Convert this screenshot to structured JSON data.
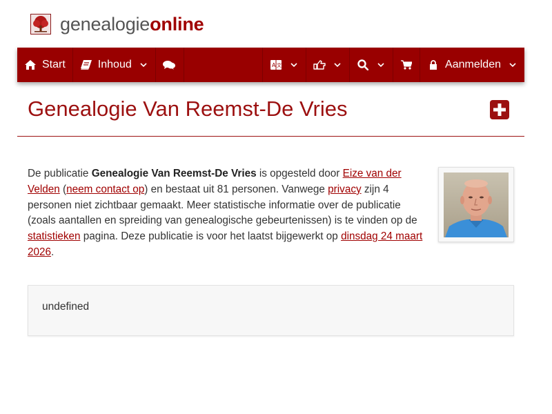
{
  "brand": {
    "name_light": "genealogie",
    "name_bold": "online",
    "logo_icon": "tree-icon"
  },
  "colors": {
    "primary": "#990000",
    "link": "#a00000",
    "title": "#9c1010"
  },
  "nav": {
    "start": {
      "icon": "home-icon",
      "label": "Start"
    },
    "inhoud": {
      "icon": "book-icon",
      "label": "Inhoud"
    },
    "chat": {
      "icon": "comments-icon"
    },
    "language": {
      "icon": "language-icon"
    },
    "share": {
      "icon": "hand-pointer-icon"
    },
    "search": {
      "icon": "search-icon"
    },
    "cart": {
      "icon": "cart-icon"
    },
    "login": {
      "icon": "lock-icon",
      "label": "Aanmelden"
    }
  },
  "page": {
    "title": "Genealogie Van Reemst-De Vries"
  },
  "description": {
    "p1": "De publicatie ",
    "pub_name": "Genealogie Van Reemst-De Vries",
    "p2": " is opgesteld door ",
    "author_link": "Eize van der Velden",
    "p3": " (",
    "contact_link": "neem contact op",
    "p4": ") en bestaat uit 81 personen. Vanwege ",
    "privacy_link": "privacy",
    "p5": " zijn 4 personen niet zichtbaar gemaakt. Meer statistische informatie over de publicatie (zoals aantallen en spreiding van genealogische gebeurtenissen) is te vinden op de ",
    "stats_link": "statistieken",
    "p6": " pagina. Deze publicatie is voor het laatst bijgewerkt op ",
    "date_link": "dinsdag 24 maart 2026",
    "p7": "."
  },
  "card": {
    "text": "undefined"
  }
}
